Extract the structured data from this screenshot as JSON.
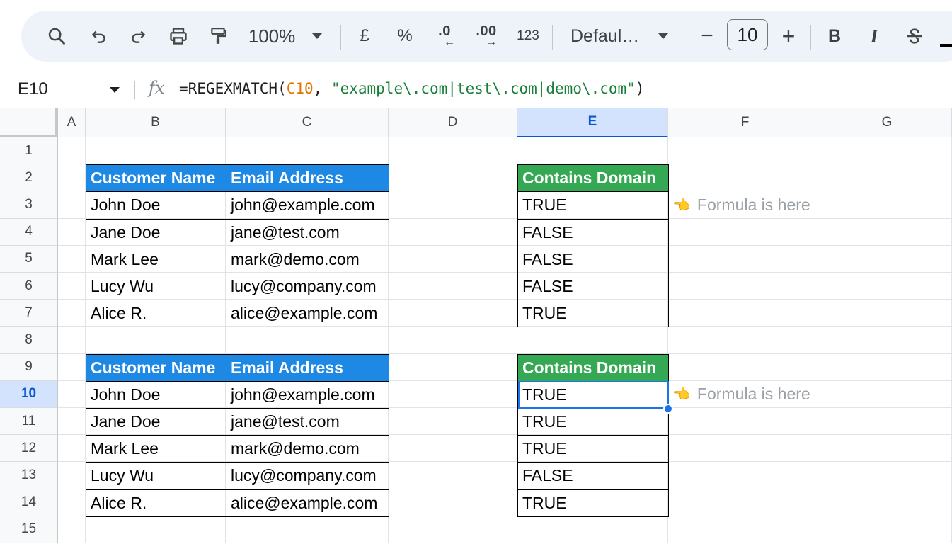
{
  "toolbar": {
    "zoom": "100%",
    "currency": "£",
    "percent": "%",
    "decrease_decimal": ".0",
    "increase_decimal": ".00",
    "number_format": "123",
    "font": "Defaul…",
    "font_size": "10",
    "minus": "−",
    "plus": "+",
    "bold": "B",
    "italic": "I"
  },
  "formula_bar": {
    "name_box": "E10",
    "fx": "fx",
    "formula_prefix": "=REGEXMATCH(",
    "formula_ref": "C10",
    "formula_comma": ", ",
    "formula_string": "\"example\\.com|test\\.com|demo\\.com\"",
    "formula_suffix": ")"
  },
  "columns": [
    "A",
    "B",
    "C",
    "D",
    "E",
    "F",
    "G"
  ],
  "selected_column": "E",
  "rows": [
    "1",
    "2",
    "3",
    "4",
    "5",
    "6",
    "7",
    "8",
    "9",
    "10",
    "11",
    "12",
    "13",
    "14",
    "15"
  ],
  "selected_row": "10",
  "table1": {
    "headers": [
      "Customer Name",
      "Email Address"
    ],
    "rows": [
      [
        "John Doe",
        "john@example.com"
      ],
      [
        "Jane Doe",
        "jane@test.com"
      ],
      [
        "Mark Lee",
        "mark@demo.com"
      ],
      [
        "Lucy Wu",
        "lucy@company.com"
      ],
      [
        "Alice R.",
        "alice@example.com"
      ]
    ],
    "result_header": "Contains Domain",
    "results": [
      "TRUE",
      "FALSE",
      "FALSE",
      "FALSE",
      "TRUE"
    ]
  },
  "table2": {
    "headers": [
      "Customer Name",
      "Email Address"
    ],
    "rows": [
      [
        "John Doe",
        "john@example.com"
      ],
      [
        "Jane Doe",
        "jane@test.com"
      ],
      [
        "Mark Lee",
        "mark@demo.com"
      ],
      [
        "Lucy Wu",
        "lucy@company.com"
      ],
      [
        "Alice R.",
        "alice@example.com"
      ]
    ],
    "result_header": "Contains Domain",
    "results": [
      "TRUE",
      "TRUE",
      "TRUE",
      "FALSE",
      "TRUE"
    ]
  },
  "notes": {
    "row3": "Formula is here",
    "row10": "Formula is here",
    "emoji": "👈"
  },
  "colors": {
    "header_blue": "#1e88e5",
    "header_green": "#34a853",
    "selection": "#1a73e8"
  }
}
